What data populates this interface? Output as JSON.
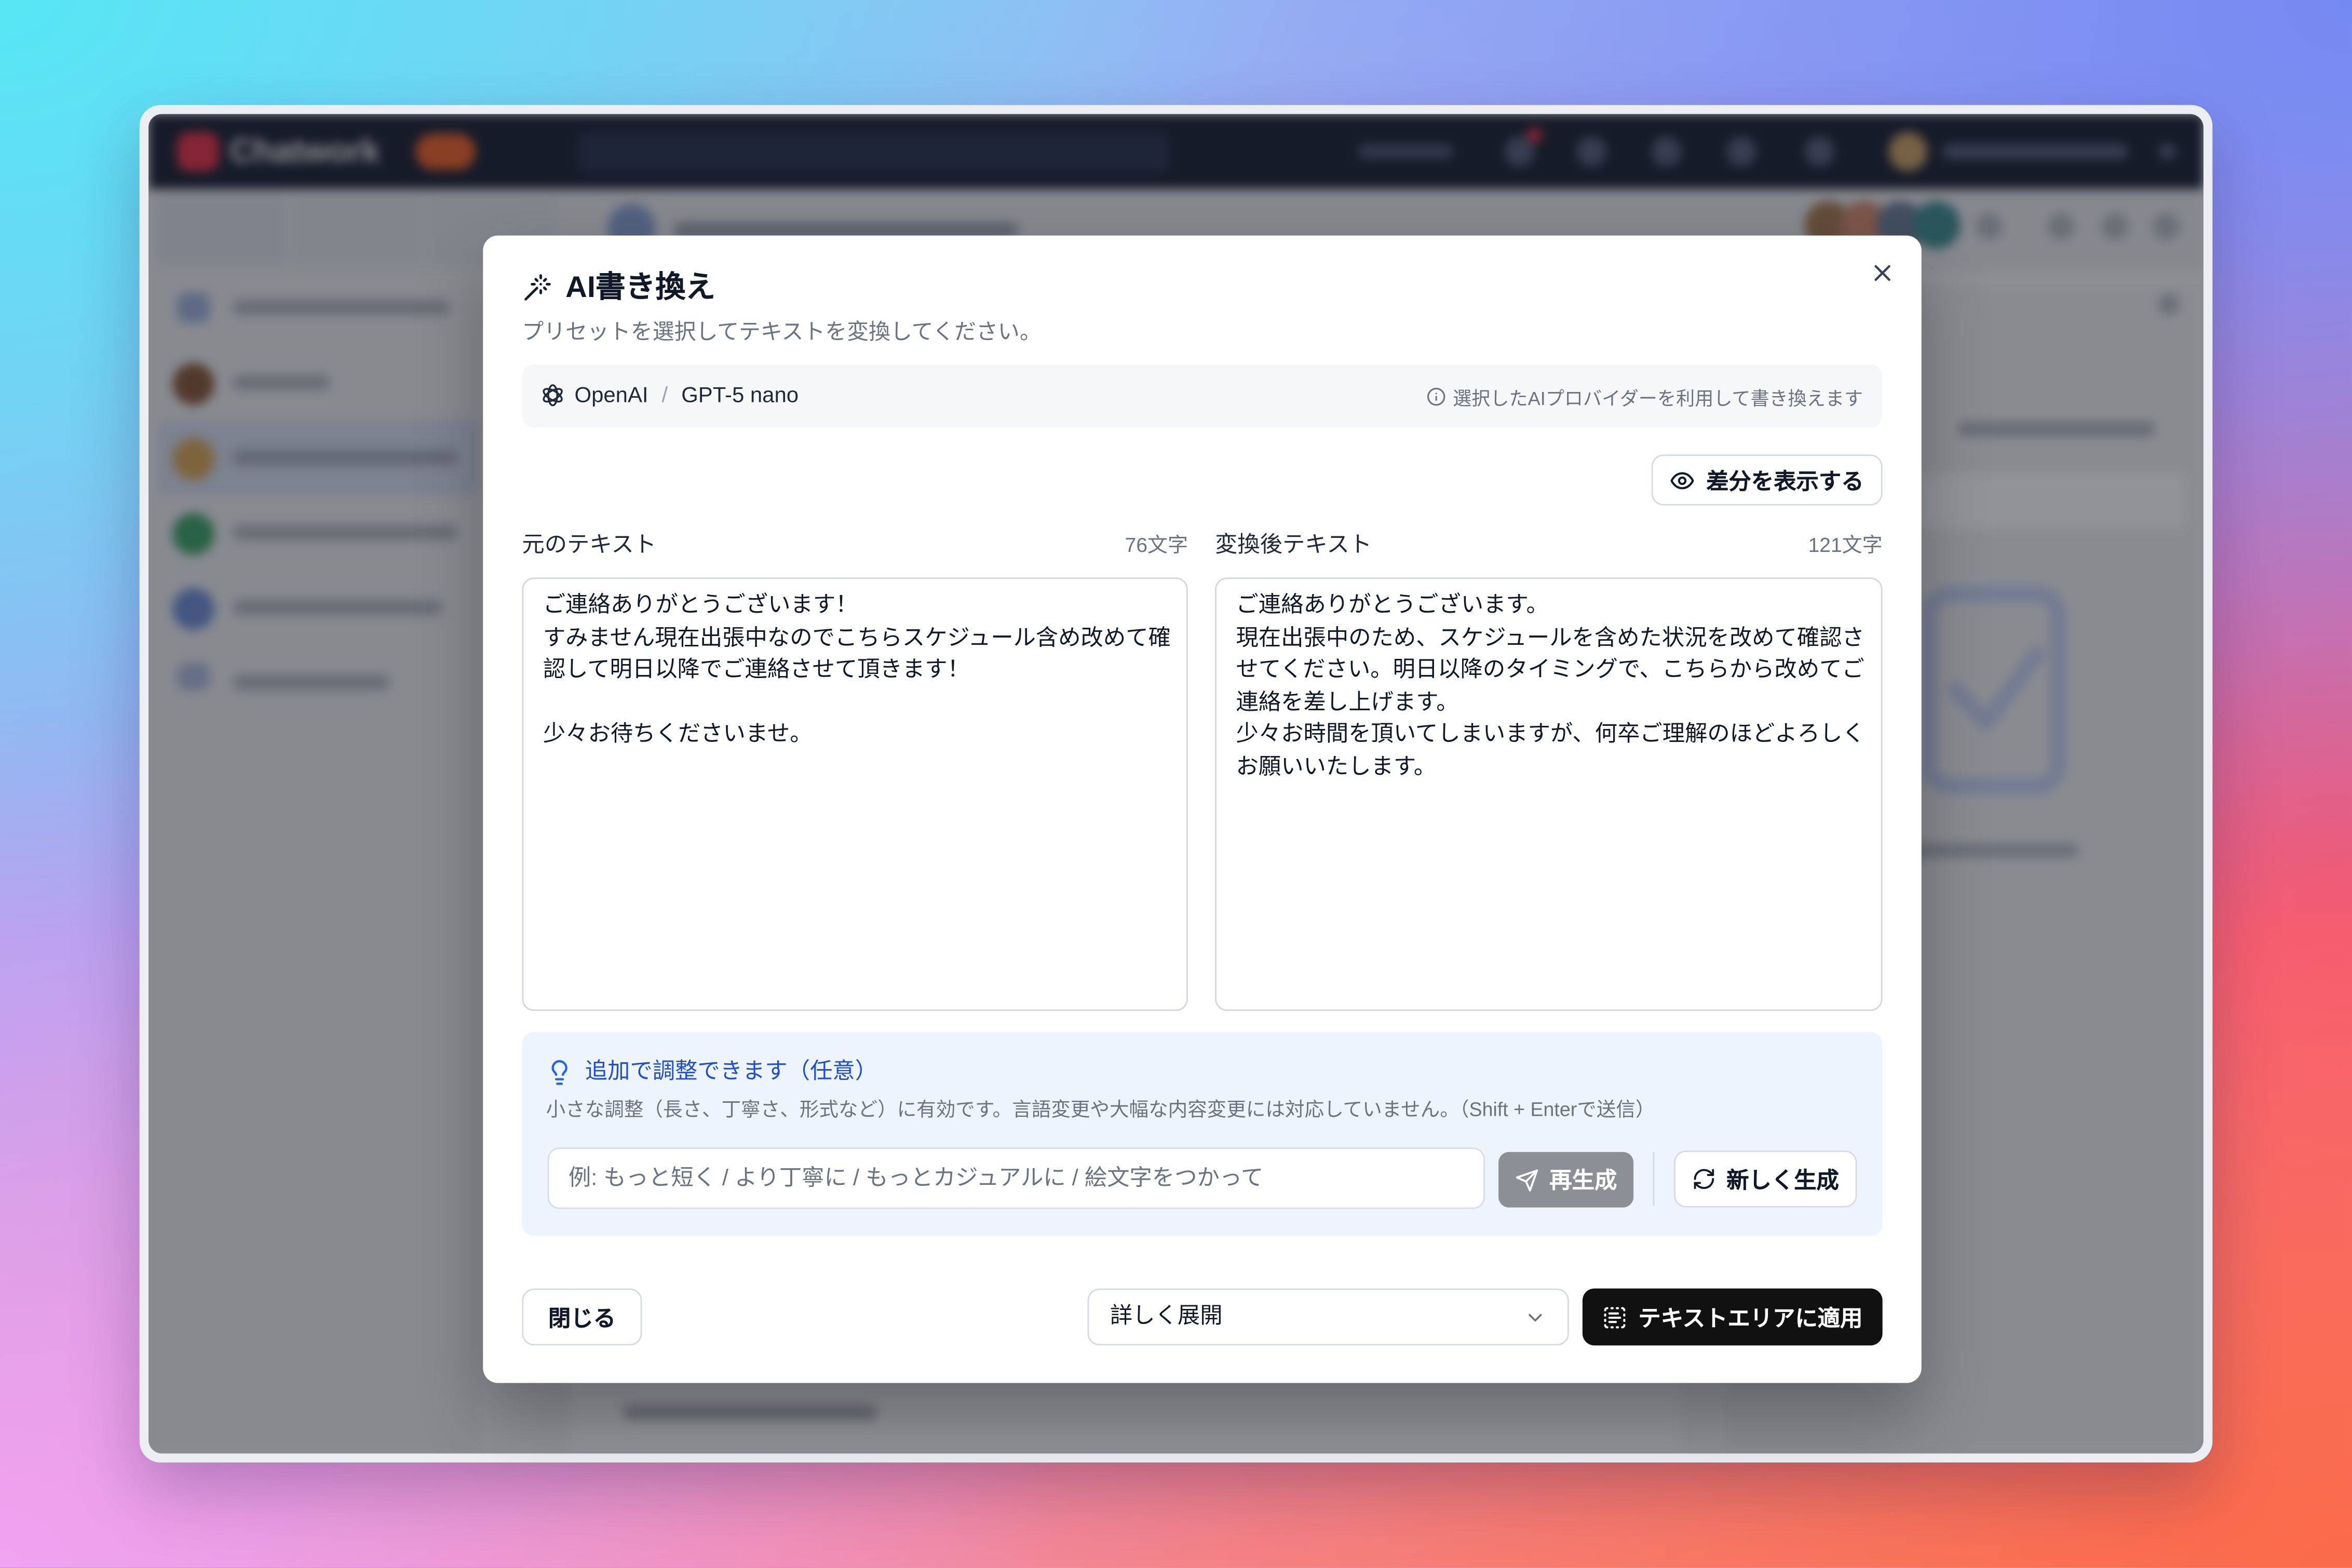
{
  "background_app": {
    "logo_text": "Chatwork"
  },
  "modal": {
    "title": "AI書き換え",
    "subtitle": "プリセットを選択してテキストを変換してください。",
    "provider": {
      "name": "OpenAI",
      "separator": "/",
      "model": "GPT-5 nano",
      "info": "選択したAIプロバイダーを利用して書き換えます"
    },
    "diff_button_label": "差分を表示する",
    "original": {
      "label": "元のテキスト",
      "count": "76文字",
      "text": "ご連絡ありがとうございます！\nすみません現在出張中なのでこちらスケジュール含め改めて確認して明日以降でご連絡させて頂きます！\n\n少々お待ちくださいませ。"
    },
    "converted": {
      "label": "変換後テキスト",
      "count": "121文字",
      "text": "ご連絡ありがとうございます。\n現在出張中のため、スケジュールを含めた状況を改めて確認させてください。明日以降のタイミングで、こちらから改めてご連絡を差し上げます。\n少々お時間を頂いてしまいますが、何卒ご理解のほどよろしくお願いいたします。"
    },
    "adjust": {
      "title": "追加で調整できます（任意）",
      "description": "小さな調整（長さ、丁寧さ、形式など）に有効です。言語変更や大幅な内容変更には対応していません。（Shift + Enterで送信）",
      "input_placeholder": "例: もっと短く / より丁寧に / もっとカジュアルに / 絵文字をつかって",
      "regenerate_label": "再生成",
      "regenerate_enabled": false,
      "new_generate_label": "新しく生成"
    },
    "footer": {
      "close_label": "閉じる",
      "preset_selected": "詳しく展開",
      "apply_label": "テキストエリアに適用"
    }
  },
  "icons": {
    "title": "wand-sparkles-icon",
    "close": "close-icon",
    "provider": "openai-logo-icon",
    "info": "info-icon",
    "diff": "eye-icon",
    "adjust": "lightbulb-icon",
    "regenerate": "send-icon",
    "new_generate": "refresh-icon",
    "select": "chevron-down-icon",
    "apply": "text-select-icon"
  },
  "colors": {
    "primary_text": "#111827",
    "muted_text": "#6b7280",
    "accent_blue": "#1d4ed8",
    "adjust_panel_bg": "#eef4fd",
    "disabled_button_bg": "#8c9096",
    "apply_button_bg": "#111111"
  }
}
